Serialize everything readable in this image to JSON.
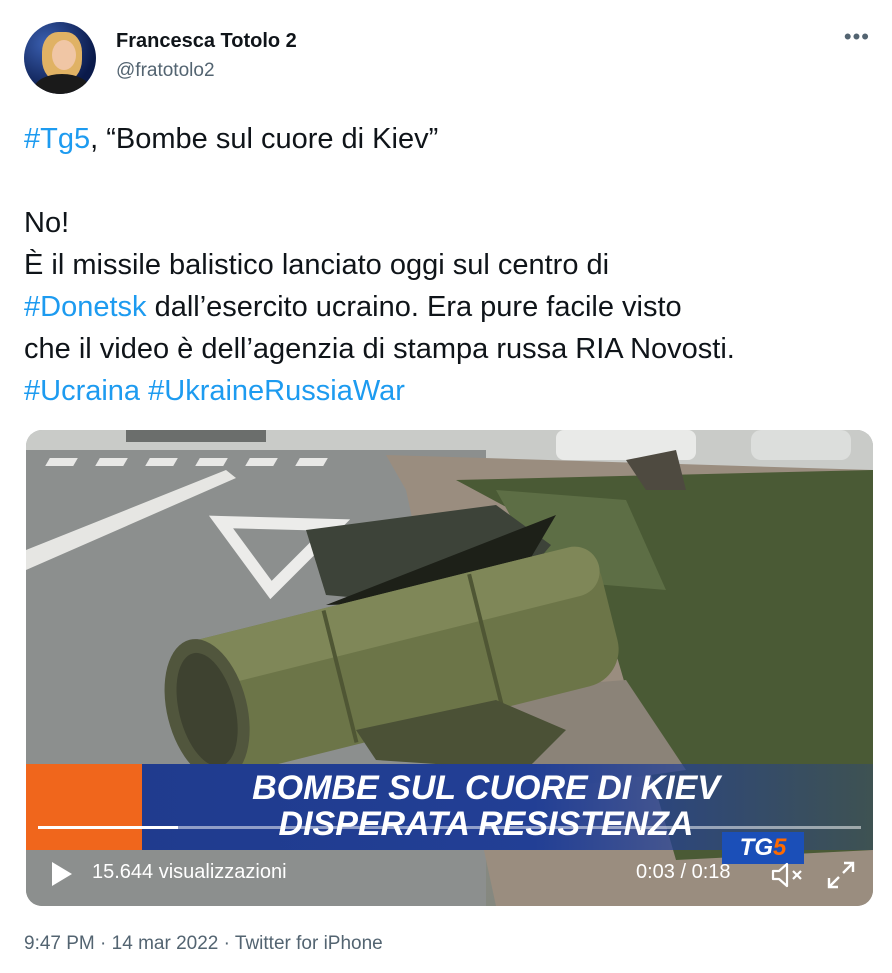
{
  "author": {
    "display_name": "Francesca Totolo 2",
    "handle": "@fratotolo2"
  },
  "more_label": "•••",
  "tweet": {
    "line1_tag": "#Tg5",
    "line1_rest": ", “Bombe sul cuore di Kiev”",
    "line2": "No!",
    "line3": "È il missile balistico lanciato oggi sul centro di",
    "line4_tag": "#Donetsk",
    "line4_rest": " dall’esercito ucraino. Era pure facile visto",
    "line5": "che il video è dell’agenzia di stampa russa RIA Novosti.",
    "line6_tag1": "#Ucraina",
    "line6_tag2": "#UkraineRussiaWar"
  },
  "video": {
    "headline_line1": "BOMBE SUL CUORE DI KIEV",
    "headline_line2": "DISPERATA RESISTENZA",
    "views": "15.644 visualizzazioni",
    "time": "0:03 / 0:18",
    "channel_tg": "TG",
    "channel_five": "5",
    "progress": 0.17
  },
  "meta": {
    "time": "9:47 PM",
    "sep": " · ",
    "date": "14 mar 2022",
    "client": "Twitter for iPhone"
  },
  "colors": {
    "link": "#1d9bf0",
    "secondary_text": "#536471",
    "lower_third_blue": "#223f95",
    "lower_third_orange": "#f0661c"
  }
}
